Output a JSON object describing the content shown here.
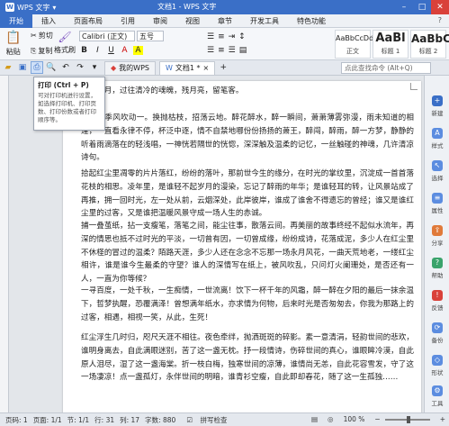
{
  "app": {
    "name": "WPS 文字",
    "doc_title": "文档1 - WPS 文字"
  },
  "menu": {
    "items": [
      "开始",
      "插入",
      "页面布局",
      "引用",
      "审阅",
      "视图",
      "章节",
      "开发工具",
      "特色功能"
    ],
    "right": "?"
  },
  "ribbon": {
    "paste": "粘贴",
    "cut": "剪切",
    "copy": "复制",
    "format_painter": "格式刷",
    "font_name": "Calibri (正文)",
    "font_size": "五号",
    "bold": "B",
    "italic": "I",
    "underline": "U",
    "styles": [
      {
        "sample": "AaBbCcDd",
        "label": "正文"
      },
      {
        "sample": "AaBl",
        "label": "标题 1"
      },
      {
        "sample": "AaBbC",
        "label": "标题 2"
      }
    ]
  },
  "tabbar": {
    "tabs": [
      "我的WPS",
      "文档1 *"
    ],
    "search_placeholder": "点此查找命令 (Alt+Q)"
  },
  "tooltip": {
    "title": "打印 (Ctrl + P)",
    "body": "可对打印机进行设置，如选择打印机、打印页数、打印份数或者打印顺序等。"
  },
  "document": {
    "paragraphs": [
      "一场风月，过往清冷的魂魄，残月亮，留笔客。",
      "春风，季风吹动一。换抛枯枝，招荡云地。醉花醉水，醉一瞬间，萧萧薄雾弥漫，雨未知道的相逢，一直看永律不停，杯泛中逐，情不自禁地哪份份扬扬的萧王，醉闯，醉雨，醉一方梦，静静的听着雨滴落在的轻浅唱，一神恍若隔世的恍惚，深深触及温柔的记忆，一丝触碰的神魂，几许清凉诗句。",
      "拾起红尘里凋零的片片落红，纷纷的落叶，那前世今生的缘分，在时光的掌纹里，沉淀成一首首落花枝的相思。凌年里，是谁轻不起岁月的漫染，忘记了醉雨的年华；是谁轻耳的转，让风景站成了再推，拥一回时光，左一处从前，云烟深处，此岸彼岸，谁成了谁舍不得遗忘的曾经；谁又是谁红尘里的过客，又是谁把温暖风景守成一场人生的赤诚。",
      "捕一叠茧纸，拈一支瘦笔，落笔之间，能尘往事，散落云间。再美丽的故事终经不起似水流年，再深的情思也抵不过时光的平淡，一切曾有因，一切曾成缘，纷纷成诗，花落成泥，多少人在红尘里不休柽的冒过的温柔？陌路天涯，多少人还在念念不忘那一场永月风花，一曲天荒地老，一缕红尘相许，谁是谁今生最柔的守望？谁人的深情写在纸上，被风吹乱，只问灯火阑珊处，是否还有一人，一直为你等候？",
      "一寻百度，一处千秋，一生痴情，一世流离！饮下一杯千年的风霜，醉一醉在夕阳的最后一抹余温下，哲梦执醒，恐覆满泽！曾想满年纸水，亦求情为何物，后来时光是否匆匆去，你我为那路上的过客，相遇，相视一笑，从此，生死！",
      "红尘浮生几时归，咫尺天涯不相往。夜色牵绊，抛洒斑斑的碎影。素一意清涓，轻韵世间的悲欢，谁明身离去，自此满眼迷别，苦了这一盏无枕。抒一段情诗，伤碎世间的真心，谁眼眸冷漠，自此原人泪尽，湿了这一盏海棠。折一枝白梅，独寒世间的凉薄，谁情尚无恙，自此花容雪发，守了这一场凄凉！点一盏孤灯，永伴世间的明暗，谁青衫空瘦，自此即却春花，随了这一生孤独……"
    ]
  },
  "sidebar": {
    "items": [
      "新建",
      "样式",
      "选择",
      "属性",
      "分享",
      "帮助",
      "反馈",
      "备份",
      "形状",
      "工具"
    ]
  },
  "status": {
    "page": "页码: 1",
    "pages": "页面: 1/1",
    "section": "节: 1/1",
    "row": "行: 31",
    "col": "列: 17",
    "words": "字数: 880",
    "spell": "拼写检查",
    "zoom": "100 %"
  }
}
